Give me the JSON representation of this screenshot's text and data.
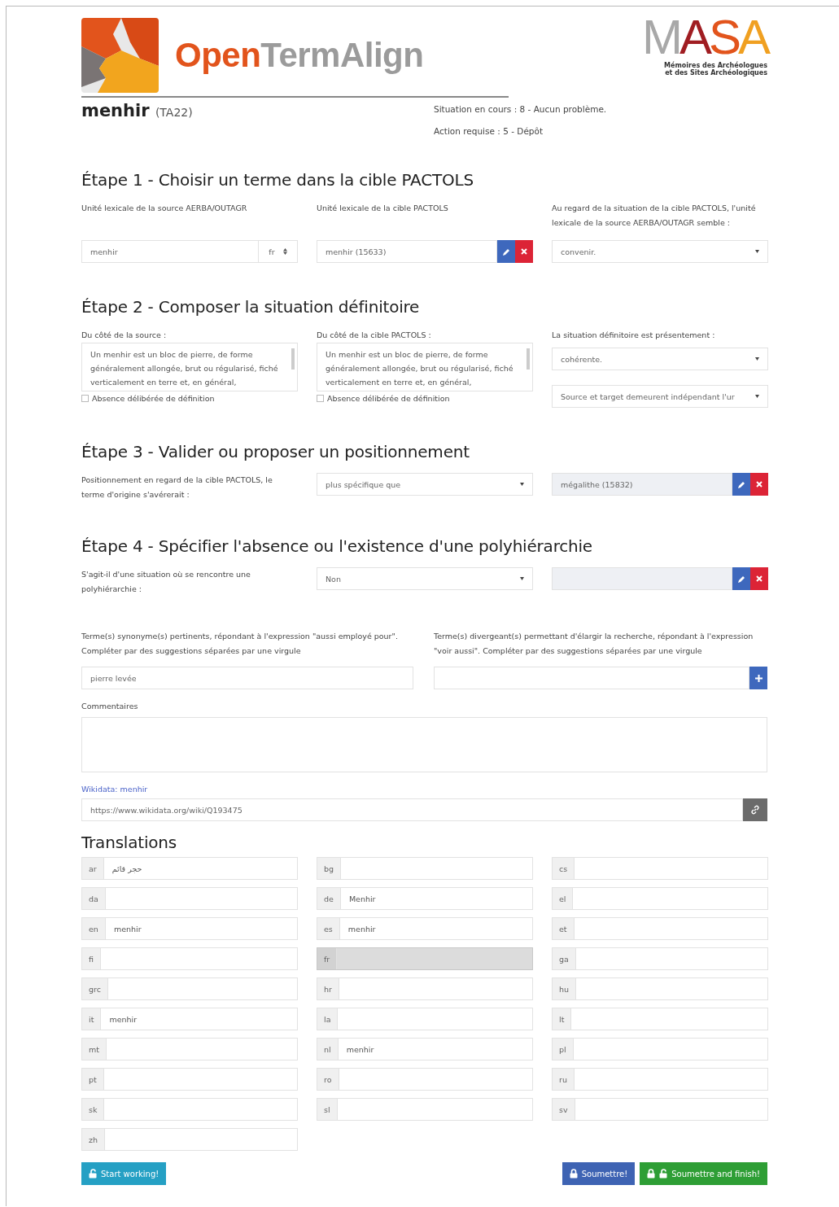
{
  "header": {
    "app_name": {
      "first": "Open",
      "second": "TermAlign"
    },
    "partner_logo": {
      "name": "MASA",
      "lines": [
        "Mémoires des Archéologues",
        "et des Sites Archéologiques"
      ]
    }
  },
  "term": {
    "name": "menhir",
    "code": "(TA22)"
  },
  "status": [
    "Situation en cours : 8 - Aucun problème.",
    "Action requise : 5 - Dépôt"
  ],
  "step1": {
    "title": "Étape 1 - Choisir un terme dans la cible PACTOLS",
    "source_label": "Unité lexicale de la source AERBA/OUTAGR",
    "source_value": "menhir",
    "source_lang": "fr",
    "target_label": "Unité lexicale de la cible PACTOLS",
    "target_value": "menhir (15633)",
    "judgement_label": "Au regard de la situation de la cible PACTOLS, l'unité lexicale de la source AERBA/OUTAGR semble :",
    "judgement_value": "convenir."
  },
  "step2": {
    "title": "Étape 2 - Composer la situation définitoire",
    "columns": [
      {
        "label": "Du côté de la source :",
        "text": "Un menhir est un bloc de pierre, de forme généralement allongée, brut ou régularisé, fiché verticalement en terre et, en général,",
        "absence": {
          "label": "Absence délibérée de définition",
          "checked": false
        }
      },
      {
        "label": "Du côté de la cible PACTOLS :",
        "text": "Un menhir est un bloc de pierre, de forme généralement allongée, brut ou régularisé, fiché verticalement en terre et, en général,",
        "absence": {
          "label": "Absence délibérée de définition",
          "checked": false
        }
      }
    ],
    "situation_label": "La situation définitoire est présentement :",
    "situation_value": "cohérente.",
    "relation_value": "Source et target demeurent indépendant l'ur"
  },
  "step3": {
    "title": "Étape 3 - Valider ou proposer un positionnement",
    "label": "Positionnement en regard de la cible PACTOLS, le terme d'origine s'avérerait :",
    "select_value": "plus spécifique que",
    "term_value": "mégalithe (15832)"
  },
  "step4": {
    "title": "Étape 4 - Spécifier l'absence ou l'existence d'une polyhiérarchie",
    "label": "S'agit-il d'une situation où se rencontre une polyhiérarchie :",
    "select_value": "Non"
  },
  "synonyms": {
    "label": "Terme(s) synonyme(s) pertinents, répondant à l'expression \"aussi employé pour\". Compléter par des suggestions séparées par une virgule",
    "value": "pierre levée"
  },
  "divergent": {
    "label": "Terme(s) divergeant(s) permettant d'élargir la recherche, répondant à l'expression \"voir aussi\". Compléter par des suggestions séparées par une virgule"
  },
  "comments": {
    "label": "Commentaires"
  },
  "wikidata": {
    "link": "Wikidata: menhir",
    "url": "https://www.wikidata.org/wiki/Q193475"
  },
  "translations": {
    "title": "Translations",
    "items": [
      {
        "lang": "ar",
        "value": "حجر قائم",
        "disabled": false
      },
      {
        "lang": "bg",
        "disabled": false
      },
      {
        "lang": "cs",
        "disabled": false
      },
      {
        "lang": "da",
        "disabled": false
      },
      {
        "lang": "de",
        "value": "Menhir",
        "disabled": false
      },
      {
        "lang": "el",
        "disabled": false
      },
      {
        "lang": "en",
        "value": "menhir",
        "disabled": false
      },
      {
        "lang": "es",
        "value": "menhir",
        "disabled": false
      },
      {
        "lang": "et",
        "disabled": false
      },
      {
        "lang": "fi",
        "disabled": false
      },
      {
        "lang": "fr",
        "disabled": true
      },
      {
        "lang": "ga",
        "disabled": false
      },
      {
        "lang": "grc",
        "disabled": false
      },
      {
        "lang": "hr",
        "disabled": false
      },
      {
        "lang": "hu",
        "disabled": false
      },
      {
        "lang": "it",
        "value": "menhir",
        "disabled": false
      },
      {
        "lang": "la",
        "disabled": false
      },
      {
        "lang": "lt",
        "disabled": false
      },
      {
        "lang": "mt",
        "disabled": false
      },
      {
        "lang": "nl",
        "value": "menhir",
        "disabled": false
      },
      {
        "lang": "pl",
        "disabled": false
      },
      {
        "lang": "pt",
        "disabled": false
      },
      {
        "lang": "ro",
        "disabled": false
      },
      {
        "lang": "ru",
        "disabled": false
      },
      {
        "lang": "sk",
        "disabled": false
      },
      {
        "lang": "sl",
        "disabled": false
      },
      {
        "lang": "sv",
        "disabled": false
      },
      {
        "lang": "zh",
        "disabled": false
      }
    ]
  },
  "buttons": [
    {
      "label": "Start working!",
      "kind": "start"
    },
    {
      "label": "Soumettre!",
      "kind": "submit"
    },
    {
      "label": "Soumettre and finish!",
      "kind": "finish"
    }
  ]
}
